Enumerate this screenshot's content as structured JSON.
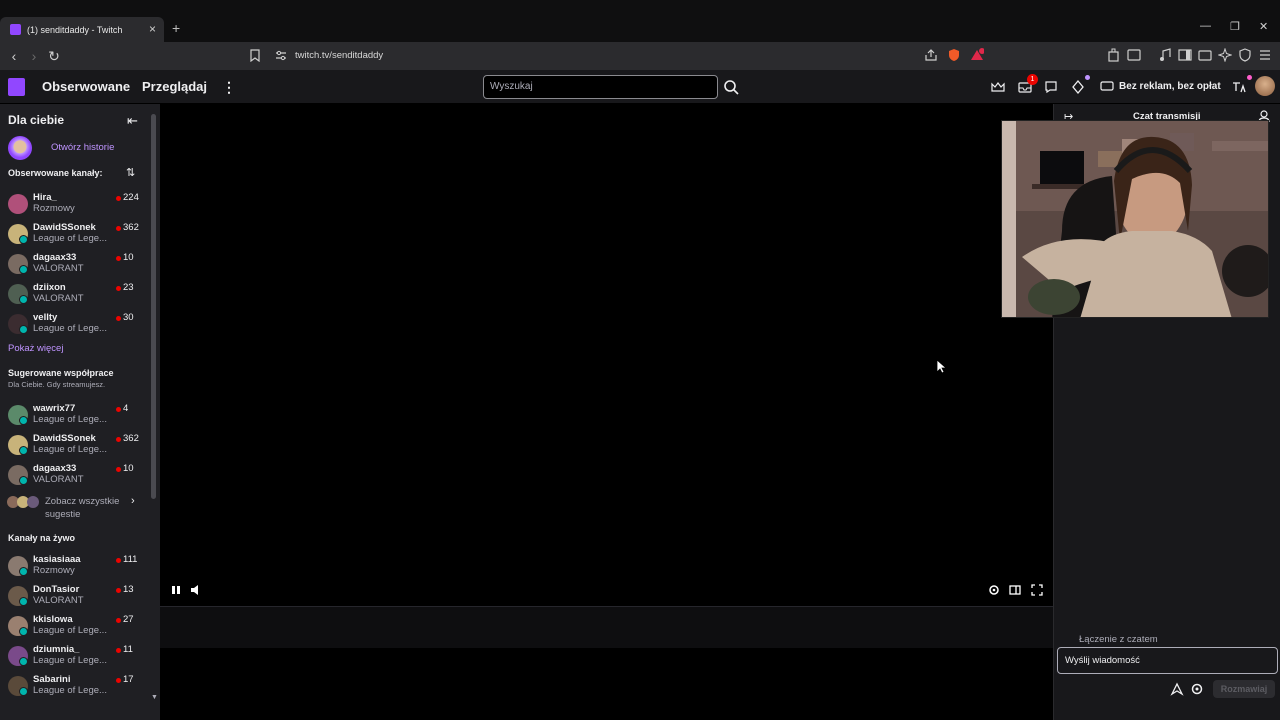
{
  "browser": {
    "tab_title": "(1) senditdaddy - Twitch",
    "new_tab_icon": "plus-icon",
    "url": "twitch.tv/senditdaddy",
    "window_controls": [
      "minimize",
      "restore",
      "close"
    ]
  },
  "nav": {
    "following": "Obserwowane",
    "browse": "Przeglądaj",
    "search_placeholder": "Wyszukaj",
    "notifications_count": "1",
    "ad_free": "Bez reklam, bez opłat",
    "brand_color": "#9147ff"
  },
  "sidebar": {
    "for_you": "Dla ciebie",
    "stories_link": "Otwórz historie",
    "followed_header": "Obserwowane kanały:",
    "followed": [
      {
        "name": "Hira_",
        "game": "Rozmowy",
        "viewers": "224",
        "color": "#b0507a"
      },
      {
        "name": "DawidSSonek",
        "game": "League of Lege...",
        "viewers": "362",
        "color": "#c8b37a"
      },
      {
        "name": "dagaax33",
        "game": "VALORANT",
        "viewers": "10",
        "color": "#7a6b62"
      },
      {
        "name": "dziixon",
        "game": "VALORANT",
        "viewers": "23",
        "color": "#4f5f52"
      },
      {
        "name": "vellty",
        "game": "League of Lege...",
        "viewers": "30",
        "color": "#3b2c30"
      }
    ],
    "show_more": "Pokaż więcej",
    "suggested_header": "Sugerowane współprace",
    "suggested_sub": "Dla Ciebie. Gdy streamujesz.",
    "suggested": [
      {
        "name": "wawrix77",
        "game": "League of Lege...",
        "viewers": "4",
        "color": "#5b8a6a"
      },
      {
        "name": "DawidSSonek",
        "game": "League of Lege...",
        "viewers": "362",
        "color": "#c8b37a"
      },
      {
        "name": "dagaax33",
        "game": "VALORANT",
        "viewers": "10",
        "color": "#7a6b62"
      }
    ],
    "see_all_line1": "Zobacz wszystkie",
    "see_all_line2": "sugestie",
    "live_header": "Kanały na żywo",
    "live": [
      {
        "name": "kasiasiaaa",
        "game": "Rozmowy",
        "viewers": "111",
        "color": "#8a7a70"
      },
      {
        "name": "DonTasior",
        "game": "VALORANT",
        "viewers": "13",
        "color": "#6b5a4a"
      },
      {
        "name": "kkislowa",
        "game": "League of Lege...",
        "viewers": "27",
        "color": "#9a8070"
      },
      {
        "name": "dziumnia_",
        "game": "League of Lege...",
        "viewers": "11",
        "color": "#7a4a8a"
      },
      {
        "name": "Sabarini",
        "game": "League of Lege...",
        "viewers": "17",
        "color": "#5a4a3a"
      }
    ]
  },
  "chat": {
    "title": "Czat transmisji",
    "connecting": "Łączenie z czatem",
    "input_placeholder": "Wyślij wiadomość",
    "send_button": "Rozmawiaj"
  }
}
